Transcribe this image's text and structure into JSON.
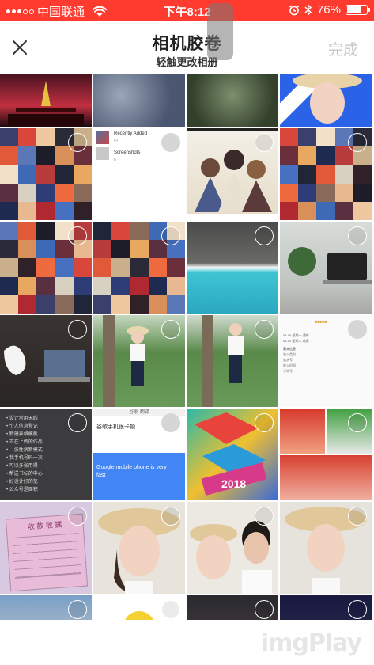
{
  "status_bar": {
    "carrier": "中国联通",
    "time": "下午8:12",
    "battery": "76%",
    "battery_level": 0.76
  },
  "nav": {
    "title": "相机胶卷",
    "subtitle": "轻触更改相册",
    "done_label": "完成",
    "close_icon": "close-icon"
  },
  "album_menu": {
    "items": [
      {
        "name": "Recently Added",
        "count": "47"
      },
      {
        "name": "Screenshots",
        "count": "5"
      }
    ]
  },
  "texts": {
    "app_header": "谷歌 翻译",
    "query": "谷歌手机很卡顿",
    "result": "Google mobile phone is very fast",
    "book_text": "2018",
    "receipt_title": "收 款 收 据"
  },
  "list_lines": [
    "设计常用无线",
    "个人信息登记",
    "新建表格模板",
    "正在上传的作品",
    "—张性病新模式",
    "我手机号码一次",
    "可以多张用得",
    "帮送书标的中心",
    "好设计好的范",
    "公众号是面积"
  ],
  "doc_text": [
    "04-09 星期一 通知",
    "04-10 星期二 成绩",
    "基本信息",
    "收入类别",
    "流水号",
    "收入时间",
    "订单号"
  ],
  "colors": {
    "status_bar": "#ff3b30",
    "done_disabled": "#c7c7c7",
    "google_blue": "#4285f4"
  },
  "watermark": "imgPlay"
}
